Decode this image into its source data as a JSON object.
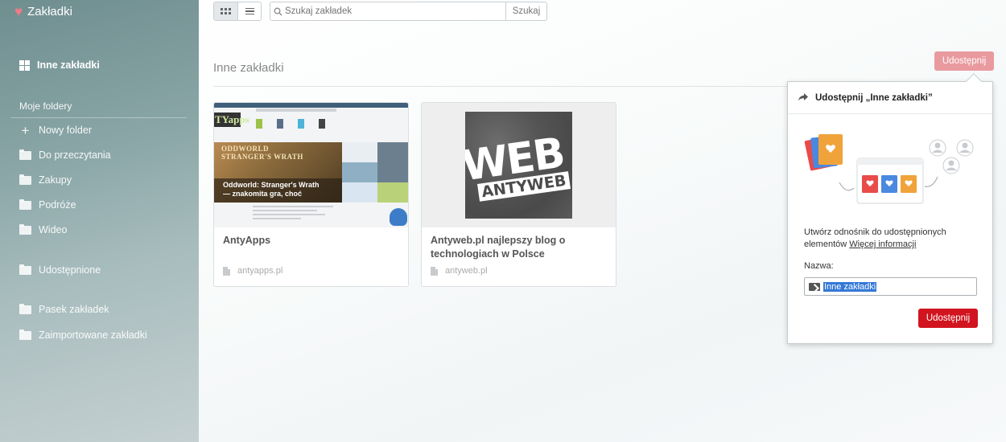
{
  "app": {
    "title": "Zakładki"
  },
  "sidebar": {
    "top_item": {
      "label": "Inne zakładki",
      "icon": "grid-icon"
    },
    "section_label": "Moje foldery",
    "new_folder": {
      "label": "Nowy folder",
      "icon": "plus-icon"
    },
    "folders": [
      {
        "label": "Do przeczytania"
      },
      {
        "label": "Zakupy"
      },
      {
        "label": "Podróże"
      },
      {
        "label": "Wideo"
      }
    ],
    "shared": {
      "label": "Udostępnione"
    },
    "other": [
      {
        "label": "Pasek zakładek"
      },
      {
        "label": "Zaimportowane zakładki"
      }
    ]
  },
  "toolbar": {
    "search": {
      "placeholder": "Szukaj zakładek",
      "button": "Szukaj"
    },
    "view_modes": [
      "grid",
      "list"
    ]
  },
  "main": {
    "heading": "Inne zakładki",
    "share_button": "Udostępnij",
    "cards": [
      {
        "title": "AntyApps",
        "url": "antyapps.pl",
        "thumb_logo": "TYapps",
        "thumb_game": "ODDWORLD\nSTRANGER'S WRATH",
        "thumb_caption": "Oddworld: Stranger's Wrath\n— znakomita gra, choć"
      },
      {
        "title": "Antyweb.pl najlepszy blog o technologiach w Polsce",
        "url": "antyweb.pl",
        "thumb_big": "WEB",
        "thumb_small": "ANTYWEB"
      }
    ]
  },
  "share_popup": {
    "title": "Udostępnij „Inne zakładki”",
    "description": "Utwórz odnośnik do udostępnionych elementów",
    "more_link": "Więcej informacji",
    "name_label": "Nazwa:",
    "name_value": "Inne zakładki",
    "submit": "Udostępnij"
  },
  "colors": {
    "accent": "#d1141f",
    "share_top": "#e99a9f",
    "heart": "#f07a88",
    "selection": "#3478d6"
  }
}
